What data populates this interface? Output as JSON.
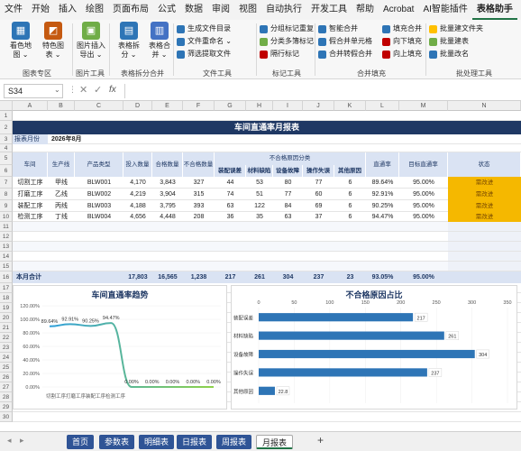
{
  "menu": [
    "文件",
    "开始",
    "插入",
    "绘图",
    "页面布局",
    "公式",
    "数据",
    "审阅",
    "视图",
    "自动执行",
    "开发工具",
    "帮助",
    "Acrobat",
    "AI智能插件",
    "表格助手"
  ],
  "ribbon": {
    "big": [
      {
        "label": "看色地\n图 ⌄",
        "color": "#2e75b6",
        "icon": "▦"
      },
      {
        "label": "特色图\n表 ⌄",
        "color": "#c55a11",
        "icon": "◩"
      },
      {
        "label": "图片插入\n导出 ⌄",
        "color": "#70ad47",
        "icon": "▣"
      },
      {
        "label": "表格拆\n分 ⌄",
        "color": "#2e75b6",
        "icon": "▤"
      },
      {
        "label": "表格合\n并 ⌄",
        "color": "#4472c4",
        "icon": "▥"
      }
    ],
    "small": [
      {
        "label": "生成文件目录",
        "color": "#2e75b6"
      },
      {
        "label": "文件重命名 ⌄",
        "color": "#2e75b6"
      },
      {
        "label": "筛选提取文件",
        "color": "#2e75b6"
      },
      {
        "label": "分组标记重复",
        "color": "#2e75b6"
      },
      {
        "label": "分类多簿标记",
        "color": "#70ad47"
      },
      {
        "label": "隔行标记",
        "color": "#c00000"
      },
      {
        "label": "智能合并",
        "color": "#2e75b6"
      },
      {
        "label": "假合并单元格",
        "color": "#2e75b6"
      },
      {
        "label": "合并转假合并",
        "color": "#2e75b6"
      },
      {
        "label": "填充合并",
        "color": "#2e75b6"
      },
      {
        "label": "向下填充",
        "color": "#c00000"
      },
      {
        "label": "向上填充",
        "color": "#c00000"
      },
      {
        "label": "批量建文件夹",
        "color": "#ffc000"
      },
      {
        "label": "批量建表",
        "color": "#70ad47"
      },
      {
        "label": "批量改名",
        "color": "#2e75b6"
      }
    ],
    "groups": [
      "图表专区",
      "图片工具",
      "表格拆分合并",
      "文件工具",
      "标记工具",
      "合并填充",
      "批处理工具"
    ]
  },
  "formula": {
    "namebox": "S34",
    "fx": "fx"
  },
  "columns": [
    "A",
    "B",
    "C",
    "D",
    "E",
    "F",
    "G",
    "H",
    "I",
    "J",
    "K",
    "L",
    "M",
    "N"
  ],
  "rows": [
    "1",
    "2",
    "3",
    "4",
    "5",
    "6",
    "7",
    "8",
    "9",
    "10",
    "11",
    "12",
    "13",
    "14",
    "15",
    "16",
    "17",
    "18",
    "19",
    "20",
    "21",
    "22",
    "23",
    "24",
    "25",
    "26",
    "27",
    "28",
    "29",
    "30"
  ],
  "report": {
    "title": "车间直通率月报表",
    "period_label": "报表月份",
    "period_value": "2026年8月",
    "headers": {
      "workshop": "车间",
      "line": "生产线",
      "product": "产品类型",
      "input": "投入数量",
      "passed": "合格数量",
      "defects": "不合格数量",
      "reasons": "不合格原因分类",
      "reason_cols": [
        "装配误差",
        "材料缺陷",
        "设备故障",
        "操作失误",
        "其他原因"
      ],
      "rate": "直通率",
      "target": "目标直通率",
      "status": "状态"
    },
    "rows": [
      {
        "workshop": "切割工序",
        "line": "甲线",
        "product": "BLW001",
        "input": "4,170",
        "passed": "3,843",
        "defects": "327",
        "r": [
          "44",
          "53",
          "80",
          "77",
          "6"
        ],
        "rate": "89.64%",
        "target": "95.00%",
        "status": "需改进"
      },
      {
        "workshop": "打磨工序",
        "line": "乙线",
        "product": "BLW002",
        "input": "4,219",
        "passed": "3,904",
        "defects": "315",
        "r": [
          "74",
          "51",
          "77",
          "60",
          "6"
        ],
        "rate": "92.91%",
        "target": "95.00%",
        "status": "需改进"
      },
      {
        "workshop": "装配工序",
        "line": "丙线",
        "product": "BLW003",
        "input": "4,188",
        "passed": "3,795",
        "defects": "393",
        "r": [
          "63",
          "122",
          "84",
          "69",
          "6"
        ],
        "rate": "90.25%",
        "target": "95.00%",
        "status": "需改进"
      },
      {
        "workshop": "检测工序",
        "line": "丁线",
        "product": "BLW004",
        "input": "4,656",
        "passed": "4,448",
        "defects": "208",
        "r": [
          "36",
          "35",
          "63",
          "37",
          "6"
        ],
        "rate": "94.47%",
        "target": "95.00%",
        "status": "需改进"
      }
    ],
    "total": {
      "label": "本月合计",
      "input": "17,803",
      "passed": "16,565",
      "defects": "1,238",
      "r": [
        "217",
        "261",
        "304",
        "237",
        "23"
      ],
      "rate": "93.05%",
      "target": "95.00%"
    }
  },
  "chart_data": [
    {
      "type": "line",
      "title": "车间直通率趋势",
      "categories": [
        "切割工序",
        "打磨工序",
        "装配工序",
        "检测工序",
        "",
        "",
        "",
        "",
        ""
      ],
      "values": [
        89.64,
        92.91,
        90.25,
        94.47,
        0,
        0,
        0,
        0,
        0
      ],
      "data_labels": [
        "89.64%",
        "92.91%",
        "90.25%",
        "94.47%",
        "0.00%",
        "0.00%",
        "0.00%",
        "0.00%",
        "0.00%"
      ],
      "ylim": [
        0,
        120
      ],
      "yticks": [
        "0.00%",
        "20.00%",
        "40.00%",
        "60.00%",
        "80.00%",
        "100.00%",
        "120.00%"
      ],
      "xlabel_text": "切割工序打磨工序装配工序检测工序",
      "color": "#2e9fdb",
      "color2": "#8ed24a"
    },
    {
      "type": "bar",
      "orientation": "horizontal",
      "title": "不合格原因占比",
      "categories": [
        "装配误差",
        "材料缺陷",
        "设备故障",
        "操作失误",
        "其他原因"
      ],
      "values": [
        217,
        261,
        304,
        237,
        22.8
      ],
      "data_labels": [
        "217",
        "261",
        "304",
        "237",
        "22.8"
      ],
      "xlim": [
        0,
        350
      ],
      "xticks": [
        "0",
        "50",
        "100",
        "150",
        "200",
        "250",
        "300",
        "350"
      ],
      "color": "#2e75b6"
    }
  ],
  "sheets": [
    "首页",
    "参数表",
    "明细表",
    "日报表",
    "周报表",
    "月报表"
  ],
  "active_sheet": "月报表",
  "add_sheet": "+"
}
